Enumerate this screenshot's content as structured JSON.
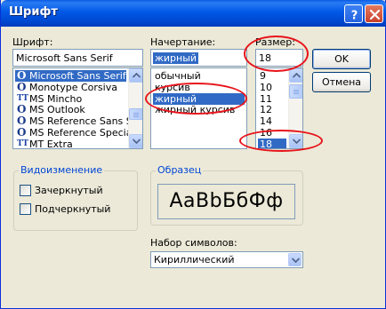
{
  "window": {
    "title": "Шрифт"
  },
  "font": {
    "label": "Шрифт:",
    "value": "Microsoft Sans Serif",
    "items": [
      {
        "name": "Microsoft Sans Serif",
        "icon": "opentype-icon",
        "selected": true
      },
      {
        "name": "Monotype Corsiva",
        "icon": "opentype-icon",
        "selected": false
      },
      {
        "name": "MS Mincho",
        "icon": "truetype-icon",
        "selected": false
      },
      {
        "name": "MS Outlook",
        "icon": "opentype-icon",
        "selected": false
      },
      {
        "name": "MS Reference Sans S",
        "icon": "opentype-icon",
        "selected": false
      },
      {
        "name": "MS Reference Specia",
        "icon": "opentype-icon",
        "selected": false
      },
      {
        "name": "MT Extra",
        "icon": "truetype-icon",
        "selected": false
      }
    ],
    "icon_glyphs": {
      "opentype": "O",
      "truetype": "TT"
    }
  },
  "style": {
    "label": "Начертание:",
    "value": "жирный",
    "items": [
      {
        "name": "обычный",
        "selected": false
      },
      {
        "name": "курсив",
        "selected": false
      },
      {
        "name": "жирный",
        "selected": true
      },
      {
        "name": "жирный курсив",
        "selected": false
      }
    ]
  },
  "size": {
    "label": "Размер:",
    "value": "18",
    "items": [
      {
        "name": "9",
        "selected": false
      },
      {
        "name": "10",
        "selected": false
      },
      {
        "name": "11",
        "selected": false
      },
      {
        "name": "12",
        "selected": false
      },
      {
        "name": "14",
        "selected": false
      },
      {
        "name": "16",
        "selected": false
      },
      {
        "name": "18",
        "selected": true
      }
    ]
  },
  "buttons": {
    "ok": "OK",
    "cancel": "Отмена"
  },
  "effects": {
    "title": "Видоизменение",
    "strikeout": {
      "label": "Зачеркнутый",
      "checked": false
    },
    "underline": {
      "label": "Подчеркнутый",
      "checked": false
    }
  },
  "sample": {
    "title": "Образец",
    "text": "AaBbБбФф"
  },
  "script": {
    "label": "Набор символов:",
    "value": "Кириллический"
  },
  "colors": {
    "title_bar": "#0058e6",
    "selection": "#316ac5",
    "annotation": "#e8141a",
    "group_title": "#0046d5"
  }
}
